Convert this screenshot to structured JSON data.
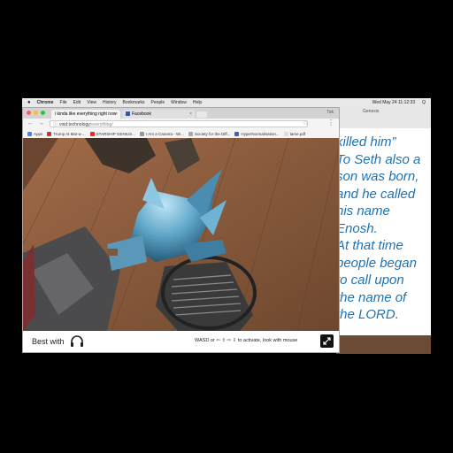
{
  "menubar": {
    "apple": "",
    "app": "Chrome",
    "items": [
      "File",
      "Edit",
      "View",
      "History",
      "Bookmarks",
      "People",
      "Window",
      "Help"
    ],
    "clock": "Wed May 24  11:12:33",
    "user": "Q"
  },
  "browser": {
    "tabs": [
      {
        "title": "i kinda like everything right now",
        "active": true
      },
      {
        "title": "Facebook",
        "active": false
      }
    ],
    "profile": "Tok",
    "url_host": "void.technology",
    "url_path": "/everything/",
    "bookmarks": [
      "Apps",
      "Trump At Mar-a-...",
      "STARSHIP GENIUS...",
      "I Am a Camera - Wi...",
      "Society for the Diff...",
      "HyperNormalisation...",
      "tarse.pdf"
    ]
  },
  "scene": {
    "footer_label": "Best with",
    "hint": "WASD or ⇦ ⇧ ⇨ ⇩ to activate, look with mouse"
  },
  "side_text": {
    "tab": "Genesis",
    "lines": [
      "killed him”",
      "To Seth also a",
      "son was born,",
      "and he called",
      "his name",
      "Enosh.",
      "At that time",
      "people began",
      "to call upon",
      "the name of",
      "the LORD."
    ]
  },
  "colors": {
    "floor": "#8a5d3f",
    "figure": "#5fa6c8",
    "poem_text": "#1e73b5",
    "menubar": "#e8e8e8"
  }
}
